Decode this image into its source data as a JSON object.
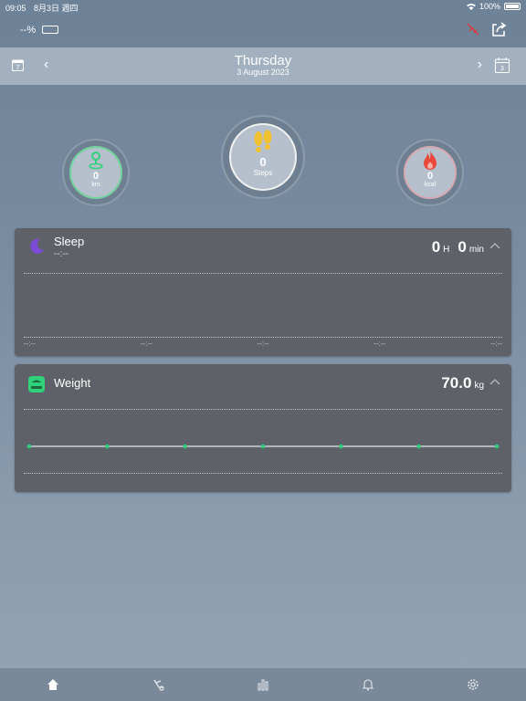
{
  "status_bar": {
    "time": "09:05",
    "date": "8月3日 週四",
    "battery": "100%"
  },
  "top_bar": {
    "device_battery": "--%"
  },
  "nav": {
    "title": "Thursday",
    "subtitle": "3 August 2023",
    "calendar_left_day": "7",
    "calendar_right_day": "3"
  },
  "rings": {
    "distance": {
      "value": "0",
      "unit": "km"
    },
    "steps": {
      "value": "0",
      "unit": "Steps"
    },
    "calories": {
      "value": "0",
      "unit": "kcal"
    }
  },
  "sleep": {
    "label": "Sleep",
    "time": "--:--",
    "hours": "0",
    "hours_unit": "H",
    "minutes": "0",
    "minutes_unit": "min",
    "ticks": [
      "--:--",
      "--:--",
      "--:--",
      "--:--",
      "--:--"
    ]
  },
  "weight": {
    "label": "Weight",
    "value": "70.0",
    "unit": "kg",
    "points": 7
  },
  "tabs": [
    "home-icon",
    "activity-icon",
    "stats-icon",
    "bell-icon",
    "settings-icon"
  ],
  "colors": {
    "accent_green": "#2fd17a",
    "sleep_purple": "#7b4bd8",
    "flame_red": "#e9483a",
    "steps_yellow": "#f2c233"
  }
}
